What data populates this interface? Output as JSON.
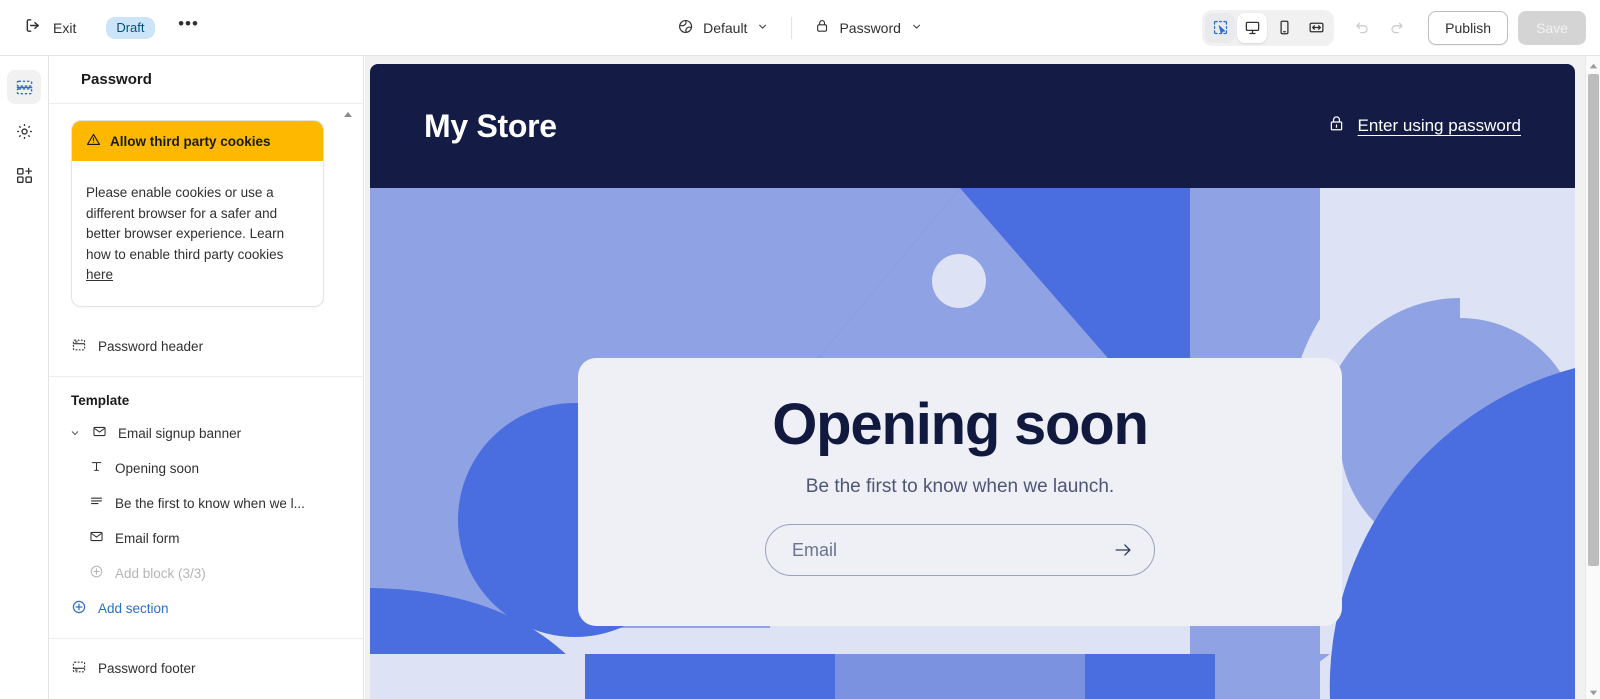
{
  "topbar": {
    "exit_label": "Exit",
    "status_badge": "Draft",
    "more_label": "•••",
    "theme_selector": "Default",
    "page_selector": "Password",
    "publish_label": "Publish",
    "save_label": "Save",
    "devices": [
      {
        "name": "select-tool",
        "state": "active"
      },
      {
        "name": "desktop",
        "state": "active"
      },
      {
        "name": "mobile",
        "state": "inactive"
      },
      {
        "name": "full-width",
        "state": "inactive"
      }
    ],
    "undo_label": "Undo",
    "redo_label": "Redo"
  },
  "rail": {
    "items": [
      {
        "label": "Sections",
        "icon": "sections-icon",
        "active": true
      },
      {
        "label": "Theme settings",
        "icon": "gear-icon",
        "active": false
      },
      {
        "label": "Apps",
        "icon": "apps-icon",
        "active": false
      }
    ]
  },
  "sidebar": {
    "title": "Password",
    "cookie_notice": {
      "heading": "Allow third party cookies",
      "body": "Please enable cookies or use a different browser for a safer and better browser experience. Learn how to enable third party cookies ",
      "link_text": "here"
    },
    "header_item": "Password header",
    "template_label": "Template",
    "blocks": [
      {
        "label": "Email signup banner",
        "icon": "envelope-icon",
        "level": 0,
        "expandable": true
      },
      {
        "label": "Opening soon",
        "icon": "text-icon",
        "level": 1
      },
      {
        "label": "Be the first to know when we l...",
        "icon": "paragraph-icon",
        "level": 1
      },
      {
        "label": "Email form",
        "icon": "envelope-icon",
        "level": 1
      }
    ],
    "add_block_label": "Add block (3/3)",
    "add_section_label": "Add section",
    "footer_item": "Password footer"
  },
  "preview": {
    "store_name": "My Store",
    "enter_password_label": "Enter using password",
    "hero_title": "Opening soon",
    "hero_subtitle": "Be the first to know when we launch.",
    "email_placeholder": "Email",
    "email_value": "",
    "submit_label": "Subscribe"
  },
  "colors": {
    "accent_blue": "#2c6ecb",
    "warning_amber": "#ffb800",
    "badge_blue_bg": "#cce4f7",
    "badge_blue_text": "#00527c",
    "store_header_navy": "#141c46",
    "hero_card": "#eef0f5",
    "bg_light": "#dde3f4",
    "bg_periwinkle": "#8fa2e4",
    "bg_blue": "#4a6de0"
  }
}
